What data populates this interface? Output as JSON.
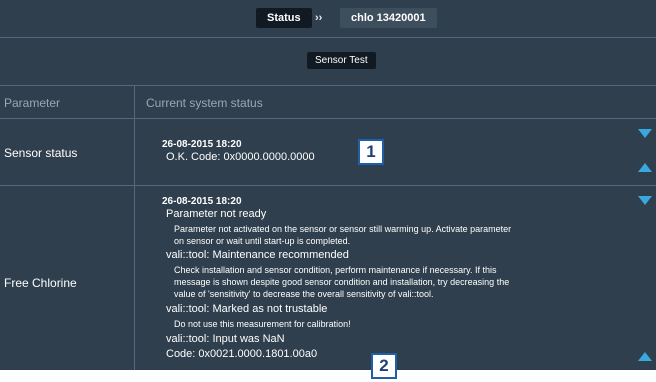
{
  "header": {
    "status_label": "Status",
    "separator": "››",
    "device_label": "chlo 13420001"
  },
  "subheader": {
    "tab_label": "Sensor Test"
  },
  "columns": {
    "parameter": "Parameter",
    "current": "Current system status"
  },
  "rows": [
    {
      "label": "Sensor status",
      "timestamp": "26-08-2015 18:20",
      "lines": [
        "O.K. Code: 0x0000.0000.0000"
      ]
    },
    {
      "label": "Free Chlorine",
      "timestamp": "26-08-2015 18:20",
      "lines": [
        "Parameter not ready",
        "Parameter not activated on the sensor or sensor still warming up. Activate parameter",
        "on sensor or wait until start-up is completed.",
        "vali::tool: Maintenance recommended",
        "Check installation and sensor condition, perform maintenance if necessary. If this",
        "message is shown despite good sensor condition and installation, try decreasing the",
        "value of 'sensitivity' to decrease the overall sensitivity of vali::tool.",
        "vali::tool: Marked as not trustable",
        "Do not use this measurement for calibration!",
        "vali::tool: Input was NaN",
        "Code: 0x0021.0000.1801.00a0"
      ]
    }
  ],
  "callouts": [
    "1",
    "2"
  ],
  "icons": {
    "scroll_down": "triangle-down-icon",
    "scroll_up": "triangle-up-icon"
  },
  "colors": {
    "background": "#2f3f4d",
    "accent": "#3aa8e0",
    "callout_border": "#1f5fa8"
  }
}
